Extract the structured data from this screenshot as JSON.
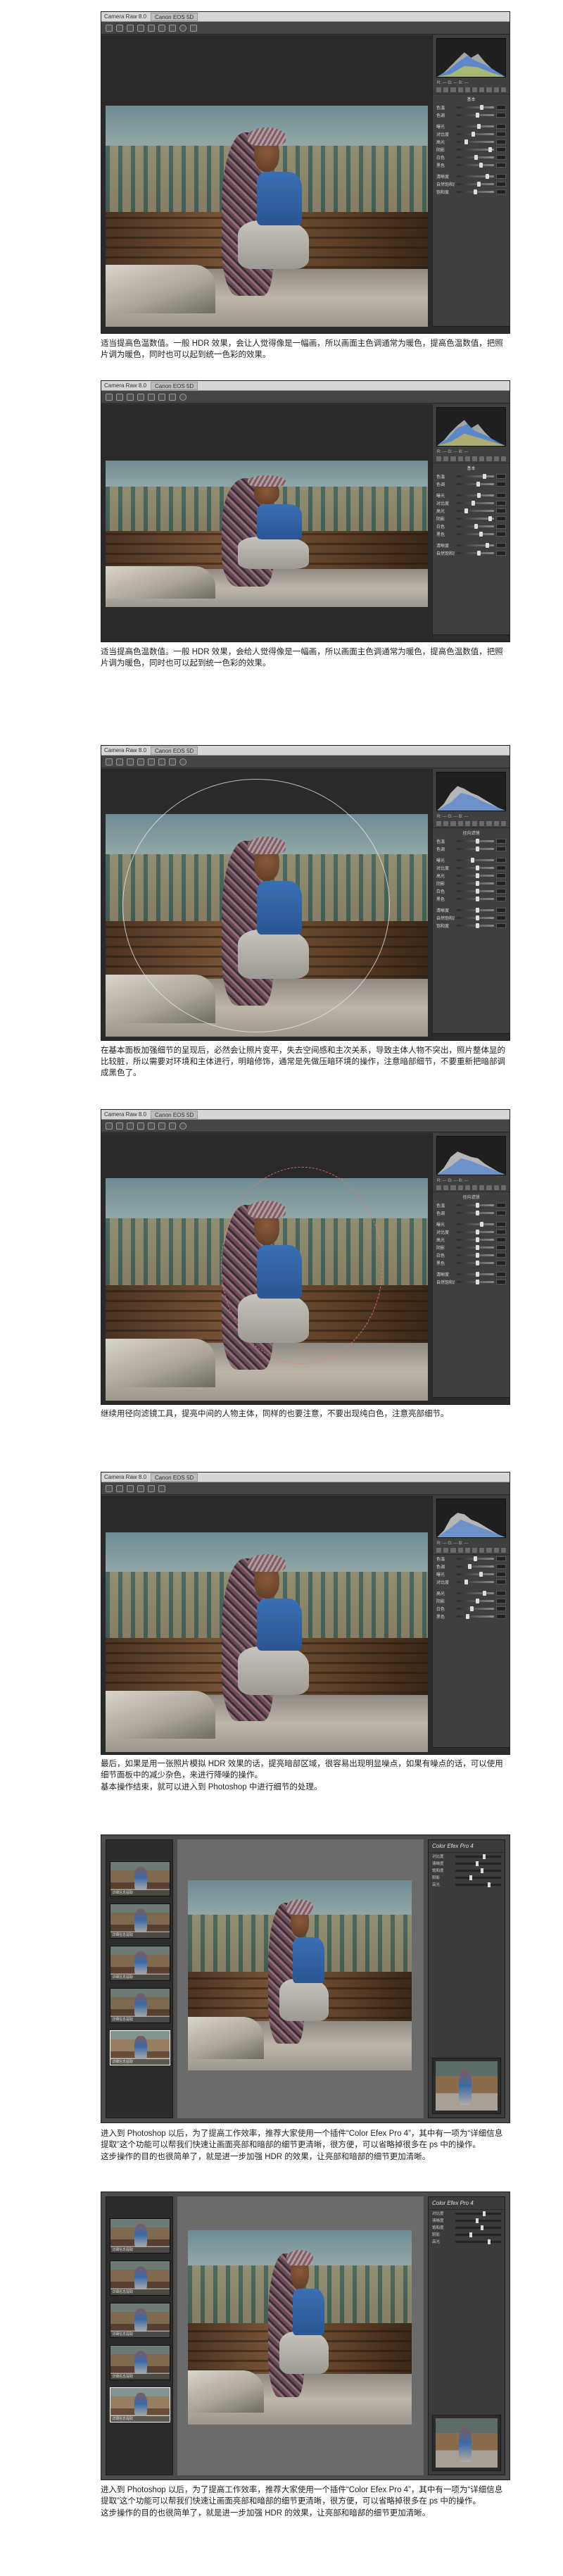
{
  "app": {
    "title": "Camera Raw 8.0",
    "file_tab": "Canon EOS 5D"
  },
  "hist_info": "R: --- G: --- B: ---",
  "sidebar": {
    "basic_header": "基本",
    "sliders": [
      "色温",
      "色调",
      "曝光",
      "对比度",
      "高光",
      "阴影",
      "白色",
      "黑色",
      "清晰度",
      "自然饱和度",
      "饱和度"
    ],
    "filter_header": "径向滤镜"
  },
  "captions": [
    [
      "适当提高色温数值。一般 HDR 效果，会让人觉得像是一幅画，所以画面主色调通常为暖色，提高色温数值，把照片调为暖色，同时也可以起到统一色彩的效果。"
    ],
    [
      "适当提高色温数值。一般 HDR 效果，会给人觉得像是一幅画，所以画面主色调通常为暖色，提高色温数值，把照片调为暖色，同时也可以起到统一色彩的效果。"
    ],
    [
      "在基本面板加强细节的呈现后，必然会让照片变平，失去空间感和主次关系，导致主体人物不突出，照片整体显的比较脏，所以需要对环境和主体进行，明暗修饰，通常是先做压暗环境的操作，注意暗部细节，不要重新把暗部调成黑色了。"
    ],
    [
      "继续用径向滤镜工具，提亮中间的人物主体，同样的也要注意，不要出现纯白色，注意亮部细节。"
    ],
    [
      "最后，如果是用一张照片模拟 HDR 效果的话，提亮暗部区域，很容易出现明显噪点，如果有噪点的话，可以使用细节面板中的减少杂色，来进行降噪的操作。",
      "基本操作结束，就可以进入到 Photoshop 中进行细节的处理。"
    ],
    [
      "进入到 Photoshop 以后，为了提高工作效率，推荐大家使用一个插件“Color Efex Pro 4”，其中有一项为“详细信息提取”这个功能可以帮我们快速让画面亮部和暗部的细节更清晰，很方便，可以省略掉很多在 ps 中的操作。",
      "这步操作的目的也很简单了，就是进一步加强 HDR 的效果，让亮部和暗部的细节更加清晰。"
    ],
    [
      "进入到 Photoshop 以后，为了提高工作效率，推荐大家使用一个插件“Color Efex Pro 4”，其中有一项为“详细信息提取”这个功能可以帮我们快速让画面亮部和暗部的细节更清晰，很方便，可以省略掉很多在 ps 中的操作。",
      "这步操作的目的也很简单了，就是进一步加强 HDR 的效果，让亮部和暗部的细节更加清晰。"
    ]
  ],
  "plugin": {
    "title": "Color Efex Pro 4",
    "thumbs": [
      "详细信息提取",
      "详细信息提取",
      "详细信息提取",
      "详细信息提取",
      "详细信息提取"
    ]
  },
  "colors": {
    "accent_red": "#d22222",
    "panel_bg": "#3a3a3a"
  }
}
